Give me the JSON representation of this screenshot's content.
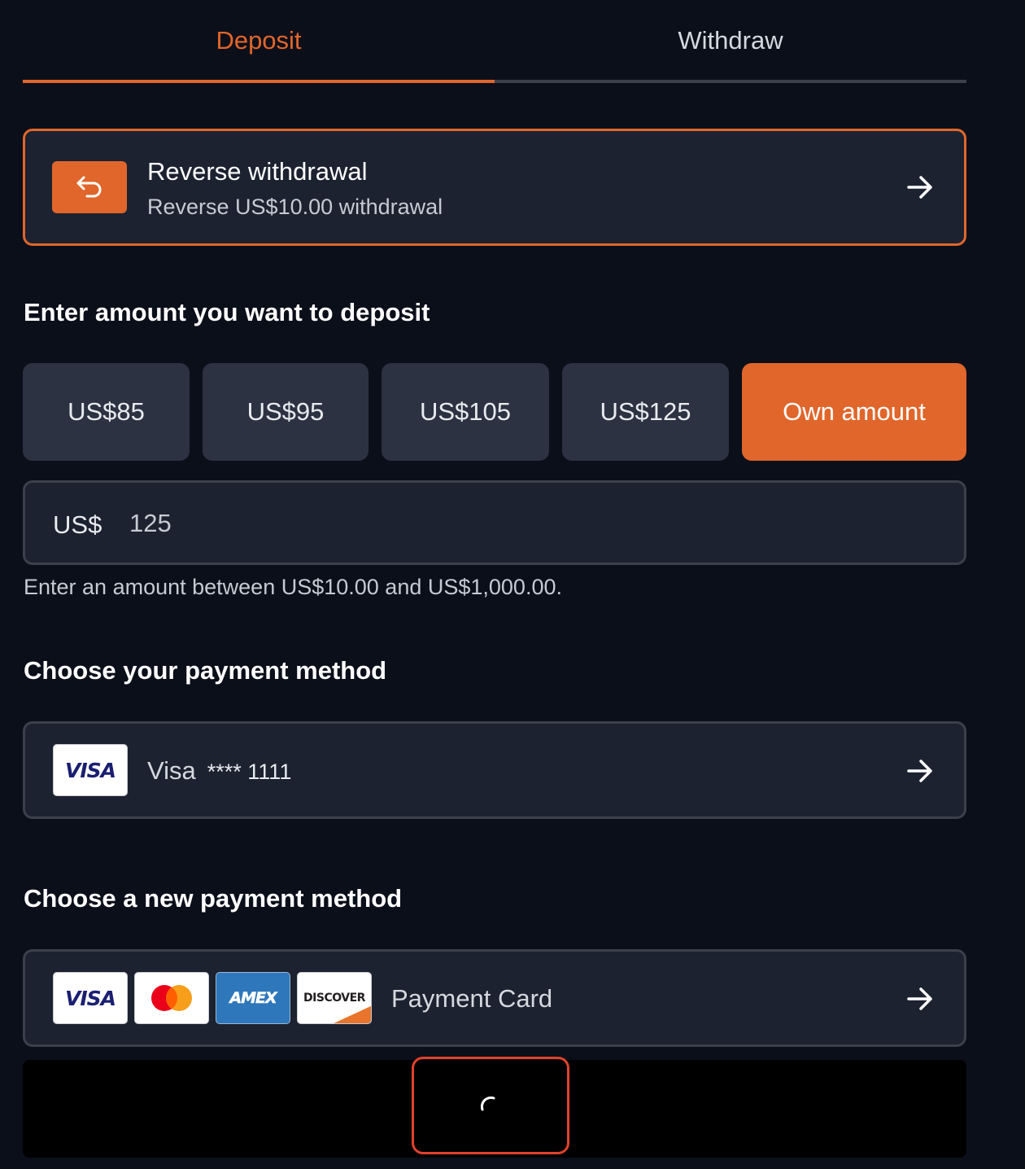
{
  "tabs": [
    {
      "label": "Deposit",
      "active": true
    },
    {
      "label": "Withdraw",
      "active": false
    }
  ],
  "reverse": {
    "title": "Reverse withdrawal",
    "subtitle": "Reverse US$10.00 withdrawal",
    "icon": "undo-arrow-icon"
  },
  "deposit": {
    "heading": "Enter amount you want to deposit",
    "amounts": [
      "US$85",
      "US$95",
      "US$105",
      "US$125",
      "Own amount"
    ],
    "selected": "Own amount",
    "currency": "US$",
    "value": "125",
    "hint": "Enter an amount between US$10.00 and US$1,000.00."
  },
  "saved_method": {
    "heading": "Choose your payment method",
    "logo": "VISA",
    "brand": "Visa",
    "masked_number": "**** 1111"
  },
  "new_method": {
    "heading": "Choose a new payment method",
    "logos": {
      "visa": "VISA",
      "amex": "AMEX",
      "discover": "DISCOVER"
    },
    "label": "Payment Card"
  },
  "colors": {
    "accent": "#e0662b",
    "background": "#0b0f1a",
    "card": "#1c2230",
    "button": "#2c3242",
    "loader_border": "#e0412b"
  }
}
